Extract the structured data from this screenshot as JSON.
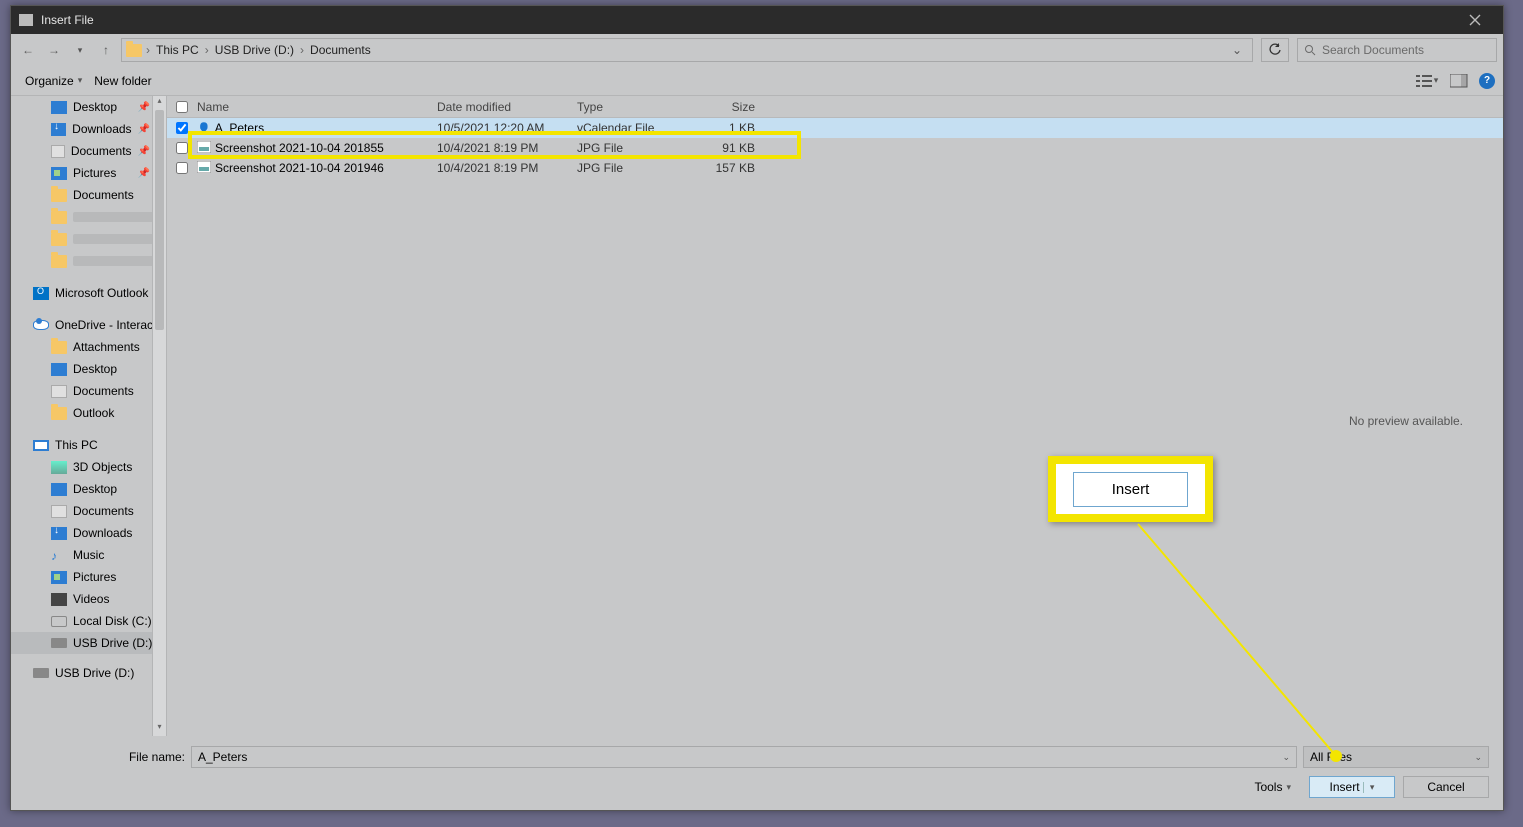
{
  "window": {
    "title": "Insert File"
  },
  "nav_buttons": {
    "back": "←",
    "forward": "→",
    "up": "↑"
  },
  "breadcrumbs": [
    "This PC",
    "USB Drive (D:)",
    "Documents"
  ],
  "search": {
    "placeholder": "Search Documents"
  },
  "toolbar": {
    "organize": "Organize",
    "newfolder": "New folder",
    "view": "view",
    "preview_toggle": "preview",
    "help": "?"
  },
  "columns": {
    "name": "Name",
    "date": "Date modified",
    "type": "Type",
    "size": "Size"
  },
  "files": [
    {
      "name": "A_Peters",
      "date": "10/5/2021 12:20 AM",
      "type": "vCalendar File",
      "size": "1 KB",
      "selected": true,
      "checked": true,
      "icon": "contact"
    },
    {
      "name": "Screenshot 2021-10-04 201855",
      "date": "10/4/2021 8:19 PM",
      "type": "JPG File",
      "size": "91 KB",
      "selected": false,
      "checked": false,
      "icon": "image"
    },
    {
      "name": "Screenshot 2021-10-04 201946",
      "date": "10/4/2021 8:19 PM",
      "type": "JPG File",
      "size": "157 KB",
      "selected": false,
      "checked": false,
      "icon": "image"
    }
  ],
  "tree": {
    "quick": [
      {
        "label": "Desktop",
        "icon": "desk",
        "pinned": true
      },
      {
        "label": "Downloads",
        "icon": "dl",
        "pinned": true
      },
      {
        "label": "Documents",
        "icon": "doc",
        "pinned": true
      },
      {
        "label": "Pictures",
        "icon": "pic",
        "pinned": true
      },
      {
        "label": "Documents",
        "icon": "folder",
        "pinned": false
      },
      {
        "label": "",
        "icon": "folder",
        "pinned": false,
        "smear": true
      },
      {
        "label": "",
        "icon": "folder",
        "pinned": false,
        "smear": true
      },
      {
        "label": "",
        "icon": "folder",
        "pinned": false,
        "smear": true
      }
    ],
    "outlook": "Microsoft Outlook",
    "onedrive": "OneDrive - Interact",
    "onedrive_children": [
      {
        "label": "Attachments",
        "icon": "folder"
      },
      {
        "label": "Desktop",
        "icon": "desk"
      },
      {
        "label": "Documents",
        "icon": "doc"
      },
      {
        "label": "Outlook",
        "icon": "folder"
      }
    ],
    "thispc": "This PC",
    "thispc_children": [
      {
        "label": "3D Objects",
        "icon": "obj"
      },
      {
        "label": "Desktop",
        "icon": "desk"
      },
      {
        "label": "Documents",
        "icon": "doc"
      },
      {
        "label": "Downloads",
        "icon": "dl"
      },
      {
        "label": "Music",
        "icon": "mus"
      },
      {
        "label": "Pictures",
        "icon": "pic"
      },
      {
        "label": "Videos",
        "icon": "vid"
      },
      {
        "label": "Local Disk (C:)",
        "icon": "disk"
      },
      {
        "label": "USB Drive (D:)",
        "icon": "usb",
        "selected": true
      }
    ],
    "usb_root": "USB Drive (D:)"
  },
  "preview": {
    "message": "No preview available."
  },
  "footer": {
    "filename_label": "File name:",
    "filename_value": "A_Peters",
    "filter_value": "All Files",
    "tools": "Tools",
    "insert": "Insert",
    "cancel": "Cancel"
  },
  "callout": {
    "insert_label": "Insert"
  }
}
